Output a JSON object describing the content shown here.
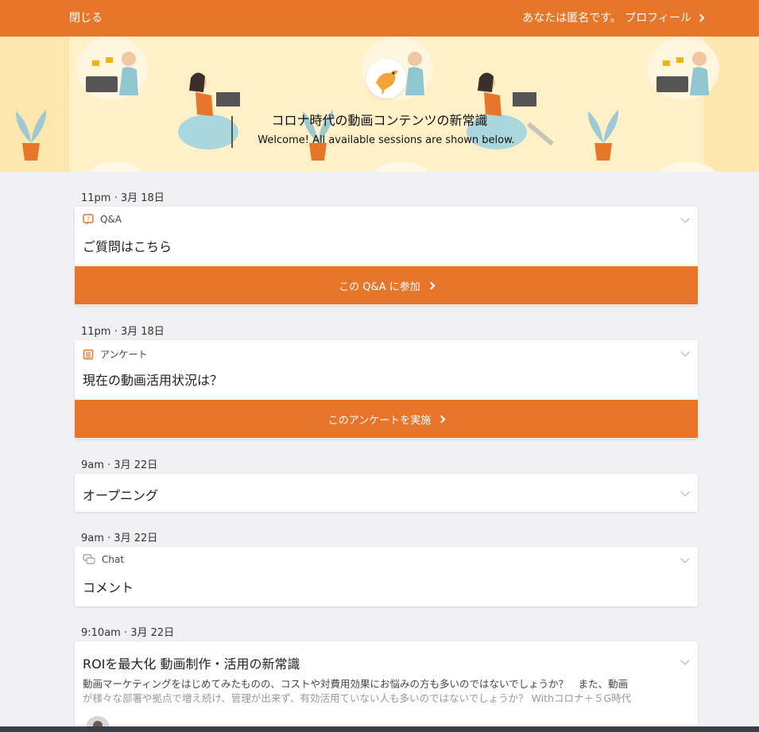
{
  "topbar": {
    "close_label": "閉じる",
    "profile_label": "あなたは匿名です。 プロフィール",
    "color": "#e8762a"
  },
  "banner": {
    "title": "コロナ時代の動画コンテンツの新常識",
    "subtitle": "Welcome! All available sessions are shown below."
  },
  "sessions": [
    {
      "date": "11pm · 3月 18日",
      "kind": "Q&A",
      "kind_icon": "question-bubble-icon",
      "title": "ご質問はこちら",
      "action_label": "この Q&A に参加"
    },
    {
      "date": "11pm · 3月 18日",
      "kind": "アンケート",
      "kind_icon": "clipboard-list-icon",
      "title": "現在の動画活用状況は？",
      "action_label": "このアンケートを実施"
    },
    {
      "date": "9am · 3月 22日",
      "title": "オープニング"
    },
    {
      "date": "9am · 3月 22日",
      "kind": "Chat",
      "kind_icon": "chat-bubbles-icon",
      "title": "コメント"
    },
    {
      "date": "9:10am · 3月 22日",
      "title": "ROIを最大化 動画制作・活用の新常識",
      "description_line1": "動画マーケティングをはじめてみたものの、コストや対費用効果にお悩みの方も多いのではないでしょうか？　また、動画",
      "description_line2": "が様々な部署や拠点で増え続け、管理が出来ず、有効活用ていない人も多いのではないでしょうか？ Withコロナ＋５G時代"
    }
  ]
}
